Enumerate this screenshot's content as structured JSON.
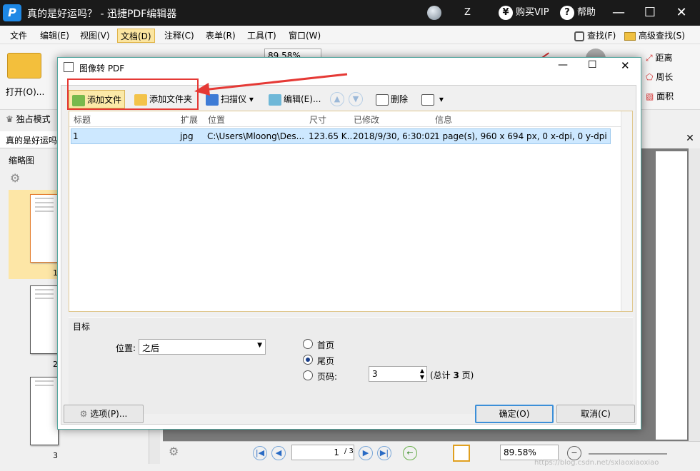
{
  "window": {
    "logo_letter": "P",
    "title": "真的是好运吗？ - 迅捷PDF编辑器",
    "user_initial": "Z",
    "buy_vip": "购买VIP",
    "help": "帮助",
    "vip_icon": "¥",
    "help_icon": "?"
  },
  "menu": [
    "文件",
    "编辑(E)",
    "视图(V)",
    "文档(D)",
    "注释(C)",
    "表单(R)",
    "工具(T)",
    "窗口(W)"
  ],
  "menu_right": {
    "find": "查找(F)",
    "advanced_find": "高级查找(S)"
  },
  "ribbon": {
    "open_label": "打开(O)...",
    "zoom_value": "89.58%",
    "distance": "距离",
    "perimeter": "周长",
    "area": "面积"
  },
  "left_panel": {
    "exclusive_mode": "独占模式",
    "doc_tab": "真的是好运吗",
    "thumbs_title": "缩略图",
    "pages": [
      "1",
      "2",
      "3"
    ]
  },
  "dialog": {
    "title": "图像转 PDF",
    "toolbar": {
      "add_file": "添加文件",
      "add_folder": "添加文件夹",
      "scanner": "扫描仪",
      "edit": "编辑(E)...",
      "delete": "删除"
    },
    "columns": [
      "标题",
      "扩展",
      "位置",
      "尺寸",
      "已修改",
      "信息"
    ],
    "rows": [
      {
        "title": "1",
        "ext": "jpg",
        "location": "C:\\Users\\Mloong\\Des...",
        "size": "123.65 K..",
        "modified": "2018/9/30, 6:30:02",
        "info": "1 page(s), 960 x 694 px, 0 x-dpi, 0 y-dpi"
      }
    ],
    "target_label": "目标",
    "position_label": "位置:",
    "position_value": "之后",
    "radio_first": "首页",
    "radio_last": "尾页",
    "radio_page": "页码:",
    "page_number": "3",
    "total_prefix": "(总计 ",
    "total_count": "3",
    "total_suffix": " 页)",
    "options_btn": "选项(P)...",
    "ok_btn": "确定(O)",
    "cancel_btn": "取消(C)"
  },
  "statusbar": {
    "page_field": "1",
    "page_total": "/ 3",
    "zoom": "89.58%",
    "watermark": "https://blog.csdn.net/sxlaoxiaoxiao"
  },
  "colors": {
    "accent": "#e53935",
    "selection": "#cde8ff",
    "title_bg": "#1a1a1a"
  }
}
